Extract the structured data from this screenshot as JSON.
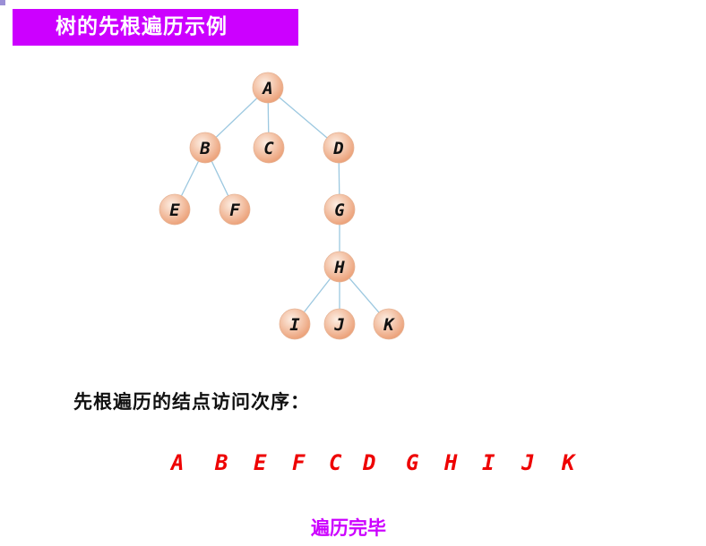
{
  "title": "树的先根遍历示例",
  "colors": {
    "banner": "#cc00ff",
    "edge": "#9cc8e0",
    "node_fill_center": "#fbe3d2",
    "node_fill_edge": "#eca27a",
    "sequence": "#ee0000",
    "done": "#cc00ff"
  },
  "tree": {
    "nodes": [
      "A",
      "B",
      "C",
      "D",
      "E",
      "F",
      "G",
      "H",
      "I",
      "J",
      "K"
    ],
    "edges": [
      [
        "A",
        "B"
      ],
      [
        "A",
        "C"
      ],
      [
        "A",
        "D"
      ],
      [
        "B",
        "E"
      ],
      [
        "B",
        "F"
      ],
      [
        "D",
        "G"
      ],
      [
        "G",
        "H"
      ],
      [
        "H",
        "I"
      ],
      [
        "H",
        "J"
      ],
      [
        "H",
        "K"
      ]
    ]
  },
  "order_heading": "先根遍历的结点访问次序：",
  "sequence": [
    "A",
    "B",
    "E",
    "F",
    "C",
    "D",
    "G",
    "H",
    "I",
    "J",
    "K"
  ],
  "done_text": "遍历完毕"
}
